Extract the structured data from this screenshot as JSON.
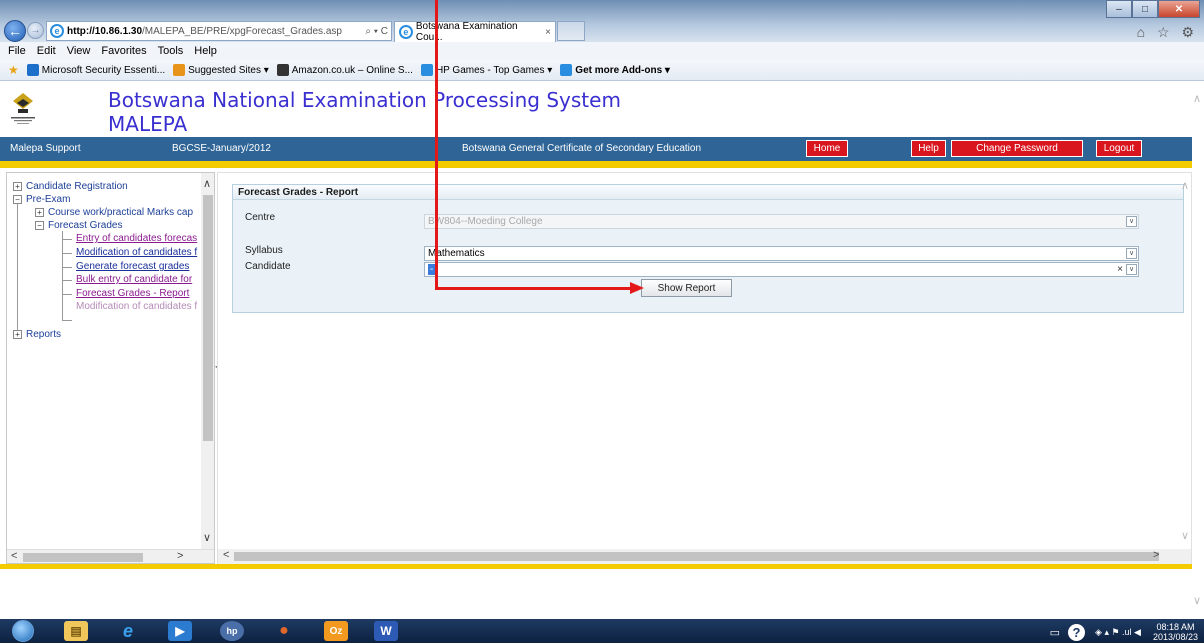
{
  "browser": {
    "url_host": "http://10.86.1.30",
    "url_path": "/MALEPA_BE/PRE/xpgForecast_Grades.asp",
    "address_tools": "⌕ ▾ C",
    "tab_title": "Botswana Examination Cou...",
    "tab_close": "×",
    "menu": [
      "File",
      "Edit",
      "View",
      "Favorites",
      "Tools",
      "Help"
    ],
    "favorites": [
      {
        "label": "Microsoft Security Essenti...",
        "color": "#1d6fc9",
        "bold": false
      },
      {
        "label": "Suggested Sites ▾",
        "color": "#e8941a",
        "bold": false
      },
      {
        "label": "Amazon.co.uk – Online S...",
        "color": "#333333",
        "bold": false
      },
      {
        "label": "HP Games - Top Games ▾",
        "color": "#2a8ee0",
        "bold": false
      },
      {
        "label": "Get more Add-ons ▾",
        "color": "#2a8ee0",
        "bold": true
      }
    ],
    "window_controls": {
      "minimize": "–",
      "maximize": "□",
      "close": "✕"
    },
    "right_icons": "⌂ ☆ ⚙"
  },
  "app": {
    "title_line1": "Botswana National Examination Processing System",
    "title_line2": "MALEPA",
    "logo_text": "BOTSWANA EXAMINATIONS COUNCIL"
  },
  "navbar": {
    "support": "Malepa Support",
    "session": "BGCSE-January/2012",
    "qualification": "Botswana General Certificate of Secondary Education",
    "buttons": {
      "home": "Home",
      "help": "Help",
      "change_password": "Change Password",
      "logout": "Logout"
    }
  },
  "tree": {
    "candidate_registration": "Candidate Registration",
    "pre_exam": "Pre-Exam",
    "course_work": "Course work/practical Marks cap",
    "forecast_grades": "Forecast Grades",
    "leaves": [
      {
        "label": "Entry of candidates forecas",
        "visited": true
      },
      {
        "label": "Modification of candidates f",
        "visited": false
      },
      {
        "label": "Generate forecast grades",
        "visited": false
      },
      {
        "label": "Bulk entry of candidate for",
        "visited": true
      },
      {
        "label": "Forecast Grades - Report",
        "visited": true
      },
      {
        "label": "Modification of candidates f",
        "visited": true
      }
    ],
    "reports": "Reports",
    "expand_plus": "+",
    "expand_minus": "−"
  },
  "report": {
    "title": "Forecast Grades - Report",
    "centre_label": "Centre",
    "centre_value": "BW804--Moeding College",
    "syllabus_label": "Syllabus",
    "syllabus_value": "Mathematics",
    "candidate_label": "Candidate",
    "candidate_value": "-",
    "show_report": "Show Report",
    "dropdown_glyph": "∨",
    "clear_glyph": "×"
  },
  "scroll": {
    "up": "∧",
    "down": "∨",
    "left": "<",
    "right": ">",
    "splitter": "◂"
  },
  "taskbar": {
    "apps": [
      {
        "name": "explorer",
        "glyph": "▤",
        "color": "#f1c75b"
      },
      {
        "name": "internet-explorer",
        "glyph": "e",
        "color": "#3aa0ee"
      },
      {
        "name": "media-player",
        "glyph": "▶",
        "color": "#2b7bd1"
      },
      {
        "name": "hp-app",
        "glyph": "hp",
        "color": "#4a6fa8"
      },
      {
        "name": "paint",
        "glyph": "●",
        "color": "#e0672a"
      },
      {
        "name": "outlook",
        "glyph": "Oz",
        "color": "#f29a1f"
      },
      {
        "name": "word",
        "glyph": "W",
        "color": "#2c5ab4"
      }
    ],
    "tray_icons": "◈ ▴ ⚑ .ul ◀",
    "help_glyph": "?",
    "time": "08:18 AM",
    "date": "2013/08/23"
  },
  "colors": {
    "app_title": "#3a2fd0",
    "navbar": "#2f6596",
    "nav_button": "#d9151e",
    "accent_yellow": "#f2cc00",
    "annotation": "#e31919"
  }
}
